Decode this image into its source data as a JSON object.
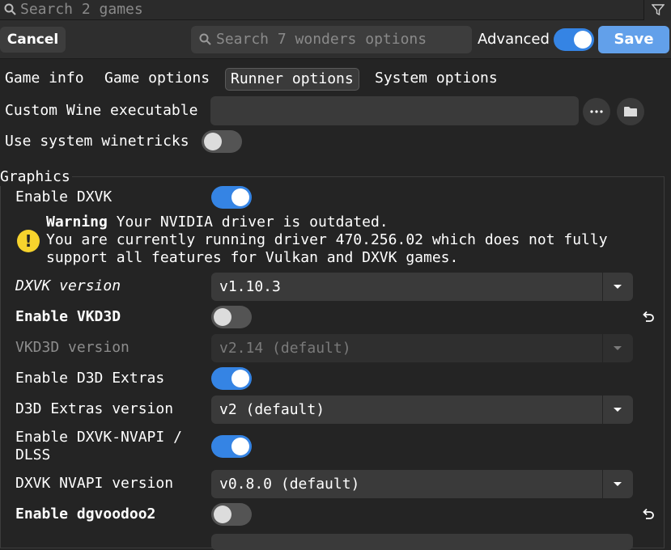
{
  "top_search": {
    "placeholder": "Search 2 games"
  },
  "header": {
    "cancel_label": "Cancel",
    "search_placeholder": "Search 7 wonders options",
    "advanced_label": "Advanced",
    "advanced_on": true,
    "save_label": "Save"
  },
  "tabs": [
    {
      "label": "Game info",
      "active": false
    },
    {
      "label": "Game options",
      "active": false
    },
    {
      "label": "Runner options",
      "active": true
    },
    {
      "label": "System options",
      "active": false
    }
  ],
  "runner": {
    "custom_wine_label": "Custom Wine executable",
    "custom_wine_value": "",
    "winetricks_label": "Use system winetricks",
    "winetricks_on": false
  },
  "graphics": {
    "section_label": "Graphics",
    "enable_dxvk_label": "Enable DXVK",
    "enable_dxvk_on": true,
    "warning_title": "Warning",
    "warning_line1": " Your NVIDIA driver is outdated.",
    "warning_line2": "You are currently running driver 470.256.02 which does not fully",
    "warning_line3": "support all features for Vulkan and DXVK games.",
    "dxvk_version_label": "DXVK version",
    "dxvk_version_value": "v1.10.3",
    "enable_vkd3d_label": "Enable VKD3D",
    "enable_vkd3d_on": false,
    "vkd3d_version_label": "VKD3D version",
    "vkd3d_version_value": "v2.14 (default)",
    "enable_d3d_extras_label": "Enable D3D Extras",
    "enable_d3d_extras_on": true,
    "d3d_extras_version_label": "D3D Extras version",
    "d3d_extras_version_value": "v2 (default)",
    "enable_nvapi_label_1": "Enable DXVK-NVAPI /",
    "enable_nvapi_label_2": "DLSS",
    "enable_nvapi_on": true,
    "nvapi_version_label": "DXVK NVAPI version",
    "nvapi_version_value": "v0.8.0 (default)",
    "enable_dgvoodoo_label": "Enable dgvoodoo2",
    "enable_dgvoodoo_on": false
  },
  "colors": {
    "accent": "#3584e4",
    "save": "#62a0ea",
    "warning": "#f6d32d",
    "background": "#242424"
  },
  "icons": [
    "search-icon",
    "filter-icon",
    "more-icon",
    "folder-icon",
    "warning-icon",
    "dropdown-arrow-icon",
    "reset-icon"
  ]
}
